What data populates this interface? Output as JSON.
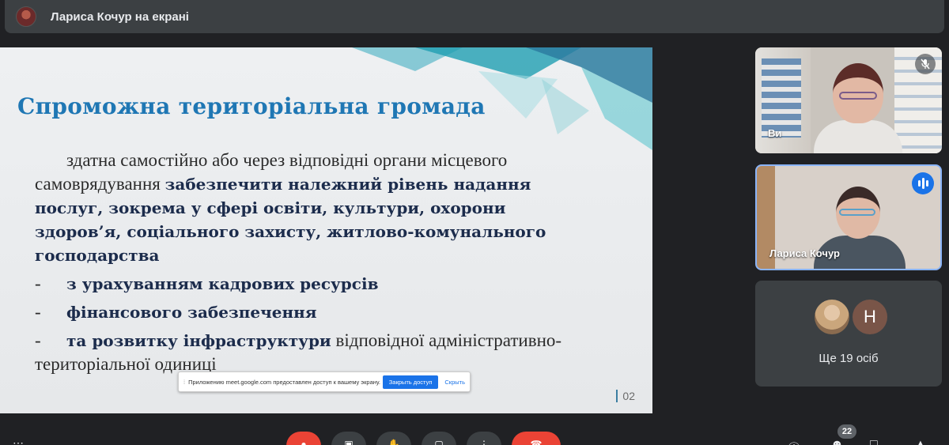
{
  "top_bar": {
    "title": "Лариса Кочур на екрані"
  },
  "slide": {
    "title": "Спроможна територіальна громада",
    "intro": "здатна самостійно або через відповідні органи місцевого самоврядування",
    "bold_part": "забезпечити належний рівень надання послуг, зокрема у сфері освіти, культури, охорони здоров’я, соціального захисту, житлово-комунального господарства",
    "bullets": [
      {
        "dash": "-",
        "bold": "з урахуванням кадрових ресурсів",
        "rest": ""
      },
      {
        "dash": "-",
        "bold": "фінансового забезпечення",
        "rest": ""
      },
      {
        "dash": "-",
        "bold": "та розвитку інфраструктури",
        "rest": " відповідної адміністративно-територіальної одиниці"
      }
    ],
    "page_number": "02"
  },
  "share_notice": {
    "grip": "⁞",
    "message": "Приложению meet.google.com предоставлен доступ к вашему экрану.",
    "stop_label": "Закрыть доступ",
    "hide_label": "Скрыть"
  },
  "participants": [
    {
      "name": "Ви",
      "muted": true
    },
    {
      "name": "Лариса Кочур",
      "speaking": true
    }
  ],
  "others": {
    "avatar_letter": "Н",
    "more_label": "Ще 19 осіб"
  },
  "controls": {
    "participants_count": "22"
  },
  "colors": {
    "background": "#202124",
    "slide_title": "#1f77b4",
    "accent_blue": "#1a73e8",
    "end_call_red": "#ea4335",
    "speaking_border": "#8ab4f8"
  }
}
